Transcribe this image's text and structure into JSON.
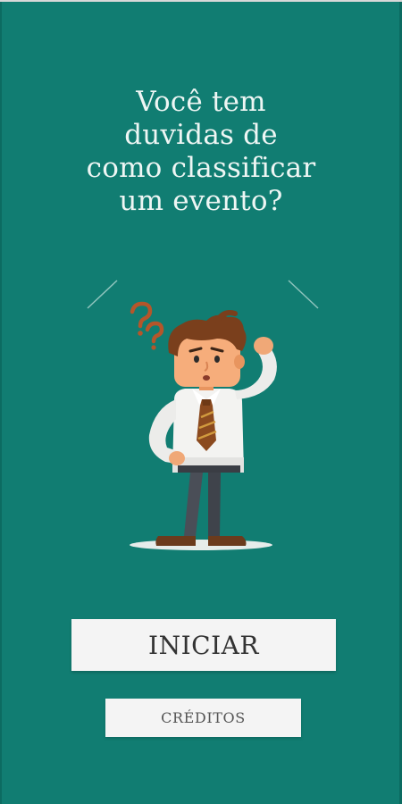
{
  "screen": {
    "background_color": "#117d72",
    "headline_lines": [
      "Você tem",
      "duvidas de",
      "como classificar",
      "um evento?"
    ]
  },
  "illustration": {
    "name": "confused-man-illustration",
    "icon": "question-marks-icon"
  },
  "actions": {
    "start_label": "INICIAR",
    "credits_label": "CRÉDITOS"
  }
}
